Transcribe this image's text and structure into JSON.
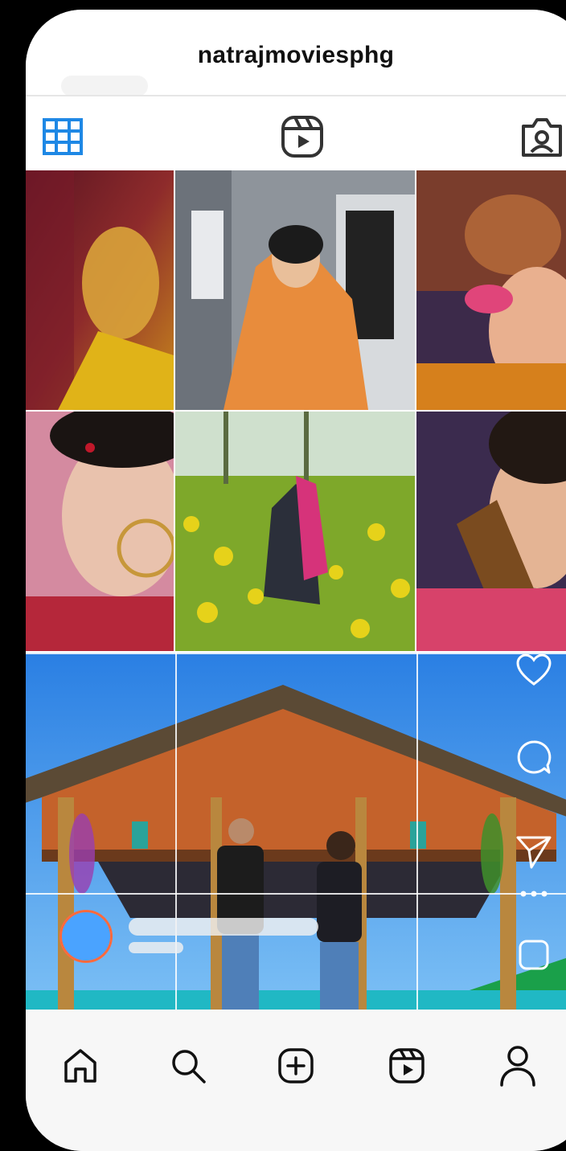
{
  "profile": {
    "username": "natrajmoviesphg"
  },
  "tabs": [
    {
      "name": "grid",
      "icon": "grid-icon",
      "active": true
    },
    {
      "name": "reels",
      "icon": "reels-icon",
      "active": false
    },
    {
      "name": "tagged",
      "icon": "tagged-icon",
      "active": false
    }
  ],
  "posts": [
    {
      "id": "post-1",
      "description_icon": "photo"
    },
    {
      "id": "post-2",
      "description_icon": "photo"
    },
    {
      "id": "post-3",
      "description_icon": "photo"
    },
    {
      "id": "post-4",
      "description_icon": "photo"
    },
    {
      "id": "post-5",
      "description_icon": "photo"
    },
    {
      "id": "post-6",
      "description_icon": "photo"
    }
  ],
  "reel_actions": [
    "heart-icon",
    "comment-icon",
    "share-icon",
    "more-icon",
    "save-icon"
  ],
  "bottom_nav": [
    "home-icon",
    "search-icon",
    "create-icon",
    "reels-icon",
    "profile-icon"
  ],
  "colors": {
    "accent": "#1e88e5",
    "avatar_fill": "#4aa3ff",
    "avatar_ring": "#ff6a3d"
  }
}
